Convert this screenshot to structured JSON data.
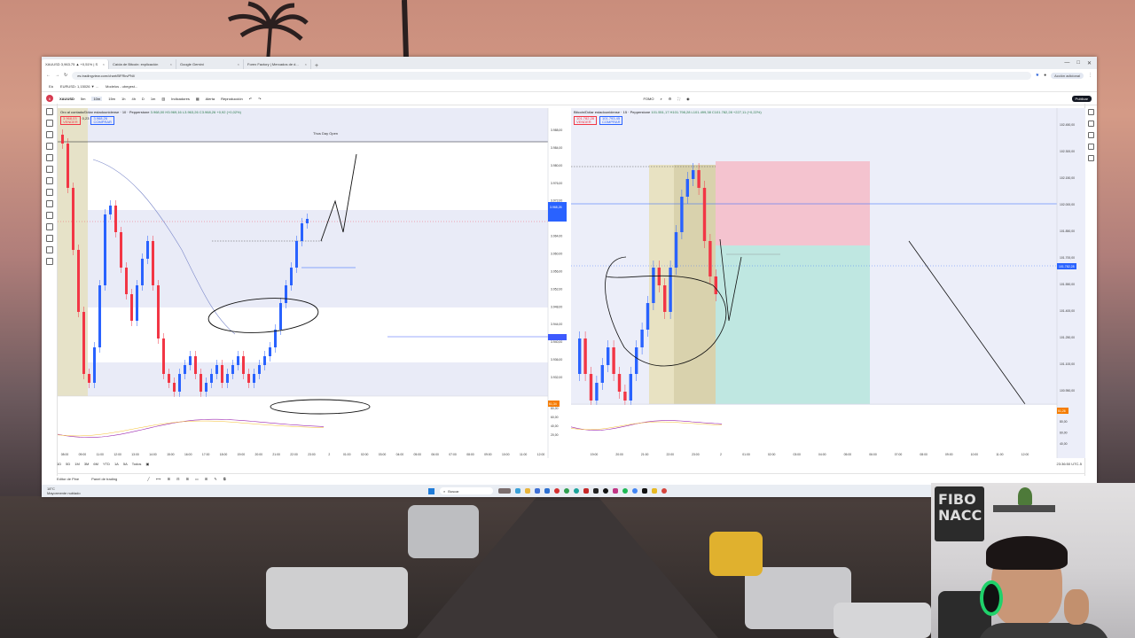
{
  "browser": {
    "tabs": [
      {
        "label": "XAUUSD 3,963.75 ▲ +0,51% | S",
        "active": true
      },
      {
        "label": "Caída de Bitcoin: explicación",
        "active": false
      },
      {
        "label": "Google Gemini",
        "active": false
      },
      {
        "label": "Forex Factory | Mercados de d...",
        "active": false
      }
    ],
    "new_tab": "+",
    "url": "es.tradingview.com/chart/BFRkvPNI/",
    "account_label": "Acción adicional",
    "bookmarks": [
      "Eá",
      "EURUSD: 1,15026 ▼ ...",
      "Modelos - ubegest..."
    ]
  },
  "toolbar": {
    "symbol": "XAUUSD",
    "intervals": [
      "5m",
      "10m",
      "15m",
      "1h",
      "4h",
      "D",
      "1m"
    ],
    "indicators": "Indicadores",
    "alert": "Alerta",
    "replay": "Reproducción",
    "layout_name": "FOMO",
    "publish": "Publicar"
  },
  "left_chart": {
    "legend": "Oro al contado/Dólar estadounidense · 10 · Pepperstone",
    "ohlc": "3.968,00  H3.969,16  L3.963,26  C3.968,26  +0,92 (+0,02%)",
    "sell": "3.968,03",
    "buy": "3.968,26",
    "sell_label": "VENDER",
    "buy_label": "COMPRAR",
    "spread": "0,23",
    "annotation": "Thus Day Open",
    "price_labels": [
      "3.988,00",
      "3.984,00",
      "3.980,00",
      "3.976,00",
      "3.972,00",
      "3.968,00",
      "3.964,00",
      "3.960,00",
      "3.956,00",
      "3.952,00",
      "3.948,00",
      "3.944,00",
      "3.940,00",
      "3.936,00",
      "3.932,00"
    ],
    "time_labels": [
      "08:00",
      "09:00",
      "11:00",
      "12:00",
      "13:00",
      "14:00",
      "15:00",
      "16:00",
      "17:00",
      "18:00",
      "19:00",
      "20:00",
      "21:00",
      "22:00",
      "23:00",
      "2",
      "01:00",
      "02:00",
      "03:00",
      "04:00",
      "05:00",
      "06:00",
      "07:00",
      "08:00",
      "09:00",
      "10:00",
      "11:00",
      "12:00"
    ],
    "rsi_labels": [
      "80,00",
      "60,00",
      "40,00",
      "20,00"
    ],
    "rsi_value": "61,34",
    "current_price": "3.968,26"
  },
  "right_chart": {
    "legend": "Bitcoin/Dólar estadounidense · 15 · Pepperstone",
    "ohlc": "101.551,17  H101.798,28  L101.499,38  C101.782,28  +227,11 (+0,22%)",
    "sell": "101.782,28",
    "buy": "101.793,45",
    "sell_label": "VENDER",
    "buy_label": "COMPRAR",
    "price_labels": [
      "102.450,00",
      "102.300,00",
      "102.150,00",
      "102.000,00",
      "101.850,00",
      "101.700,00",
      "101.550,00",
      "101.400,00",
      "101.250,00",
      "101.100,00",
      "100.950,00"
    ],
    "time_labels": [
      "19:00",
      "20:00",
      "21:00",
      "22:00",
      "23:00",
      "2",
      "01:00",
      "02:00",
      "03:00",
      "04:00",
      "05:00",
      "06:00",
      "07:00",
      "08:00",
      "09:00",
      "10:00",
      "11:00",
      "12:00"
    ],
    "rsi_labels": [
      "80,00",
      "60,00",
      "40,00"
    ],
    "rsi_value": "51,26",
    "current_price": "101.782,28"
  },
  "bottom": {
    "ranges": [
      "1D",
      "5D",
      "1M",
      "3M",
      "6M",
      "YTD",
      "1A",
      "5A",
      "Todos"
    ],
    "clock": "23:36:50 UTC-5",
    "editor": "Editor de Pine",
    "panel": "Panel de trading"
  },
  "taskbar": {
    "weather_temp": "18°C",
    "weather_desc": "Mayormente nublado",
    "search": "Buscar"
  },
  "webcam": {
    "sign": "FIBO NACC"
  },
  "colors": {
    "up": "#2962ff",
    "down": "#f23645",
    "short_zone": "#f4c3cf",
    "long_zone": "#bfe7e1"
  }
}
